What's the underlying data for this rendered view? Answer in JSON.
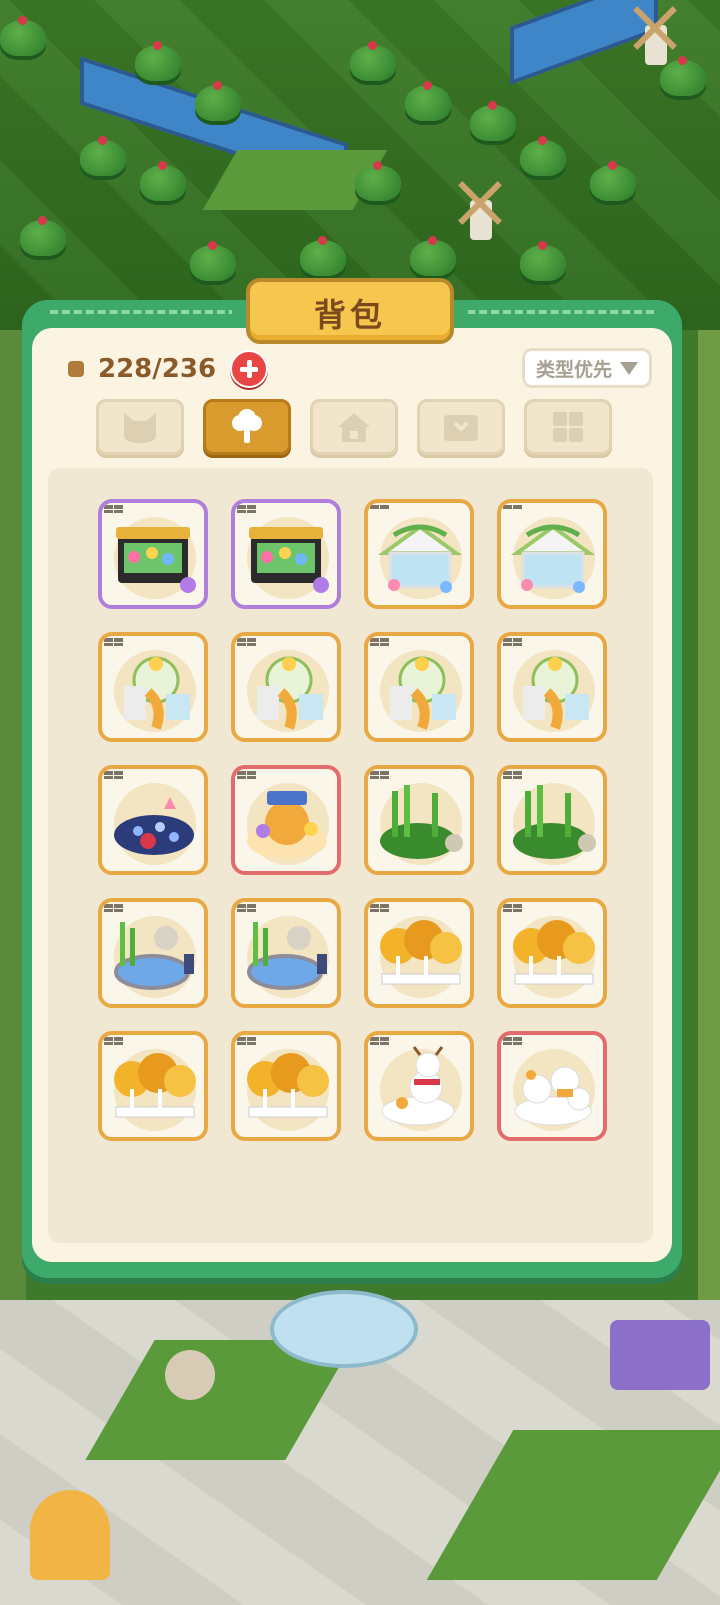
{
  "panel": {
    "title": "背包",
    "capacity": "228/236",
    "sort_label": "类型优先"
  },
  "category_tabs": [
    {
      "icon": "cat-face-icon",
      "active": false
    },
    {
      "icon": "tree-icon",
      "active": true
    },
    {
      "icon": "house-icon",
      "active": false
    },
    {
      "icon": "chest-icon",
      "active": false
    },
    {
      "icon": "grid-icon",
      "active": false
    }
  ],
  "items": [
    {
      "name": "flower-shop-stall",
      "rarity": "purple"
    },
    {
      "name": "flower-shop-stall",
      "rarity": "purple"
    },
    {
      "name": "greenhouse-cottage",
      "rarity": "orange"
    },
    {
      "name": "greenhouse-cottage",
      "rarity": "orange"
    },
    {
      "name": "glass-dome-slide-house",
      "rarity": "orange"
    },
    {
      "name": "glass-dome-slide-house",
      "rarity": "orange"
    },
    {
      "name": "glass-dome-slide-house",
      "rarity": "orange"
    },
    {
      "name": "glass-dome-slide-house",
      "rarity": "orange"
    },
    {
      "name": "blue-flower-bed",
      "rarity": "orange"
    },
    {
      "name": "autumn-carnival-stage",
      "rarity": "red"
    },
    {
      "name": "bamboo-grove",
      "rarity": "orange"
    },
    {
      "name": "bamboo-grove",
      "rarity": "orange"
    },
    {
      "name": "bamboo-pond",
      "rarity": "orange"
    },
    {
      "name": "bamboo-pond",
      "rarity": "orange"
    },
    {
      "name": "autumn-birch-grove",
      "rarity": "orange"
    },
    {
      "name": "autumn-birch-grove",
      "rarity": "orange"
    },
    {
      "name": "autumn-birch-grove",
      "rarity": "orange"
    },
    {
      "name": "autumn-birch-grove",
      "rarity": "orange"
    },
    {
      "name": "reindeer-snowman",
      "rarity": "orange"
    },
    {
      "name": "cat-snowmen",
      "rarity": "red"
    }
  ],
  "colors": {
    "frame_green": "#3eaa6a",
    "panel_cream": "#fbf4e2",
    "tab_active": "#d99a2e",
    "rarity_orange": "#e8a843",
    "rarity_purple": "#b07fdc",
    "rarity_red": "#e26b6b"
  }
}
